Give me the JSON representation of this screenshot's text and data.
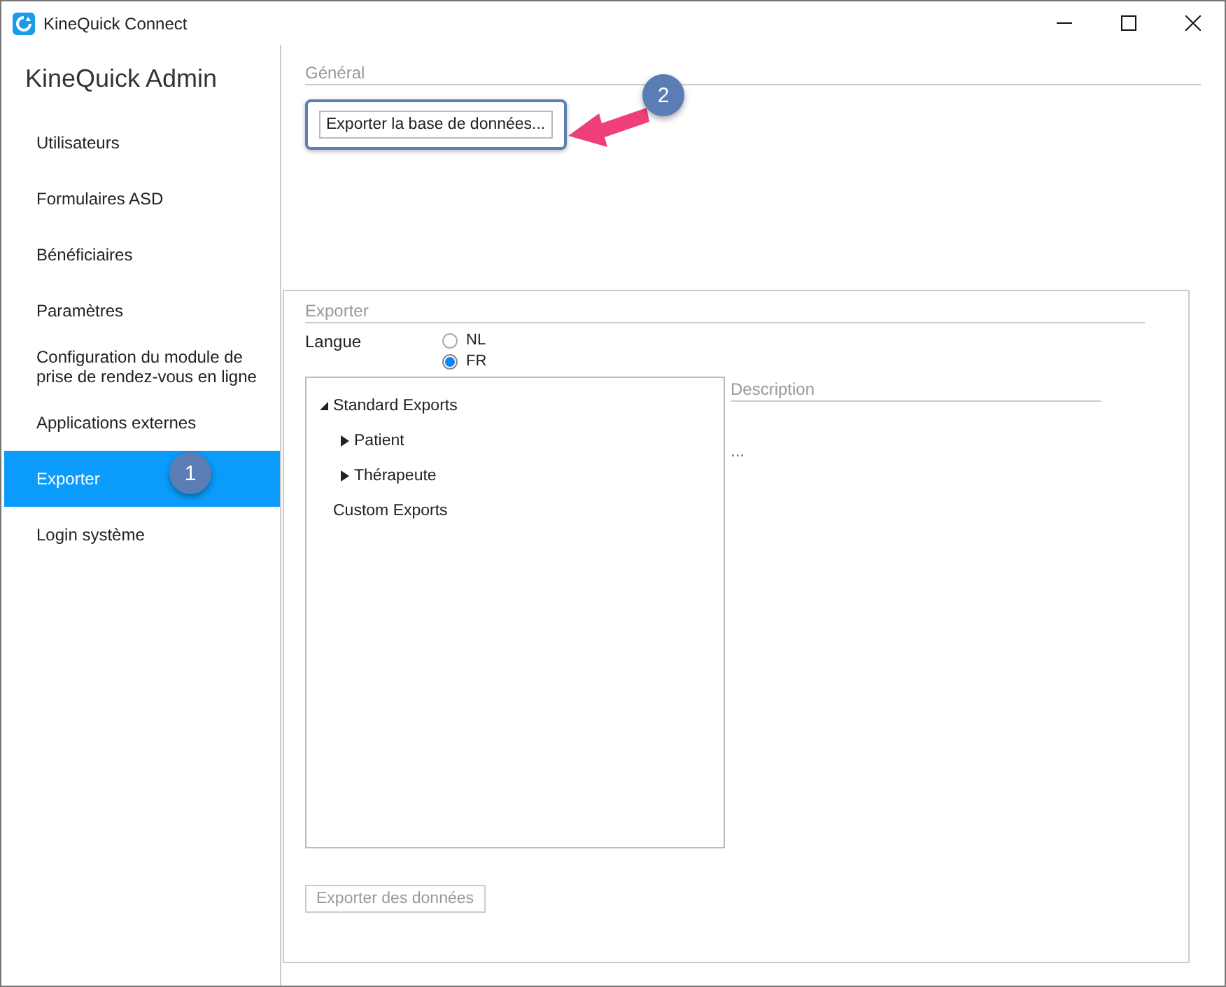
{
  "window": {
    "title": "KineQuick Connect"
  },
  "sidebar": {
    "title": "KineQuick Admin",
    "items": [
      {
        "label": "Utilisateurs",
        "selected": false
      },
      {
        "label": "Formulaires ASD",
        "selected": false
      },
      {
        "label": "Bénéficiaires",
        "selected": false
      },
      {
        "label": "Paramètres",
        "selected": false
      },
      {
        "label": "Configuration du module de prise de rendez-vous en ligne",
        "selected": false
      },
      {
        "label": "Applications externes",
        "selected": false
      },
      {
        "label": "Exporter",
        "selected": true
      },
      {
        "label": "Login système",
        "selected": false
      }
    ]
  },
  "general": {
    "heading": "Général",
    "button": "Exporter la base de données..."
  },
  "export_panel": {
    "heading": "Exporter",
    "language_label": "Langue",
    "languages": [
      {
        "label": "NL",
        "selected": false
      },
      {
        "label": "FR",
        "selected": true
      }
    ],
    "tree": [
      {
        "label": "Standard Exports",
        "expanded": true,
        "children": [
          {
            "label": "Patient",
            "expanded": false
          },
          {
            "label": "Thérapeute",
            "expanded": false
          }
        ]
      },
      {
        "label": "Custom Exports"
      }
    ],
    "description_heading": "Description",
    "description": "...",
    "export_button": {
      "label": "Exporter des données",
      "disabled": true
    }
  },
  "annotations": [
    {
      "label": "1"
    },
    {
      "label": "2"
    }
  ]
}
